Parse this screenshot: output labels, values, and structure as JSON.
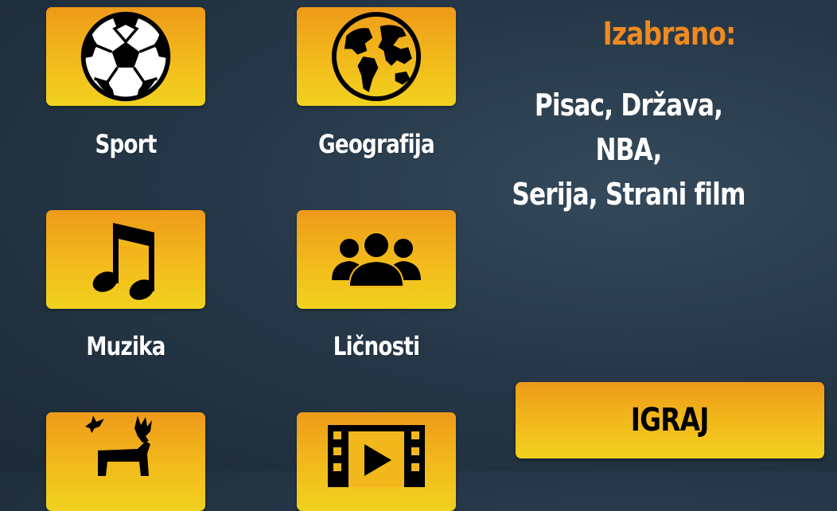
{
  "categories": [
    {
      "label": "Sport",
      "icon": "soccer-ball-icon"
    },
    {
      "label": "Geografija",
      "icon": "globe-icon"
    },
    {
      "label": "Muzika",
      "icon": "music-note-icon"
    },
    {
      "label": "Ličnosti",
      "icon": "people-icon"
    },
    {
      "label": "",
      "icon": "animals-icon"
    },
    {
      "label": "",
      "icon": "film-icon"
    }
  ],
  "selected": {
    "title": "Izabrano:",
    "line1": "Pisac, Država, NBA,",
    "line2": "Serija, Strani film"
  },
  "play_button": {
    "label": "IGRAJ"
  },
  "colors": {
    "tile_top": "#ee9a1a",
    "tile_bottom": "#f1d21f",
    "title": "#f08a1f",
    "text": "#ffffff"
  }
}
